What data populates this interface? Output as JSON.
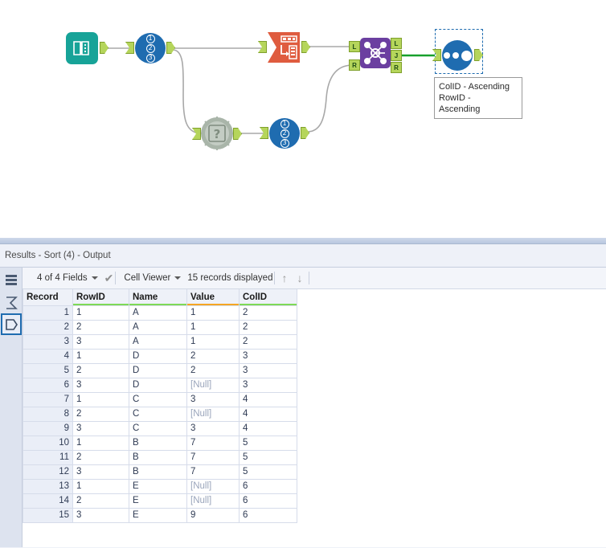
{
  "canvas": {
    "nodes": [
      {
        "id": "input-data",
        "name": "Input Data",
        "type": "input"
      },
      {
        "id": "record-id-1",
        "name": "Record ID",
        "type": "recordid",
        "digits": [
          "1",
          "2",
          "3"
        ]
      },
      {
        "id": "transpose",
        "name": "Transpose",
        "type": "transpose"
      },
      {
        "id": "unknown-tool",
        "name": "Unknown Tool",
        "type": "unknown",
        "glyph": "?"
      },
      {
        "id": "record-id-2",
        "name": "Record ID",
        "type": "recordid",
        "digits": [
          "1",
          "2",
          "3"
        ]
      },
      {
        "id": "join",
        "name": "Join",
        "type": "join",
        "ports": [
          "L",
          "J",
          "R"
        ]
      },
      {
        "id": "sort",
        "name": "Sort",
        "type": "sort",
        "selected": true
      }
    ],
    "annotation": {
      "lines": [
        "ColID - Ascending",
        "RowID -",
        "Ascending"
      ]
    },
    "colors": {
      "input_node": "#17a398",
      "recordid_node": "#1f6cb0",
      "transpose_node": "#df5c3f",
      "join_node": "#6b3fa0",
      "sort_node": "#1f6cb0",
      "unknown_node": "#9aa79a",
      "connector_plug": "#b5d55b",
      "wire": "#a8a8a8",
      "wire_active": "#17a02c",
      "selection": "#1f6cb0"
    }
  },
  "results": {
    "title": "Results - Sort (4) - Output",
    "toolbar": {
      "fields_label": "4 of 4 Fields",
      "check_icon": "✔",
      "viewer_label": "Cell Viewer",
      "records_label": "15 records displayed",
      "up_icon": "↑",
      "down_icon": "↓"
    },
    "rail": {
      "items": [
        {
          "name": "data-rows-icon",
          "selected": false
        },
        {
          "name": "sigma-icon",
          "selected": false
        },
        {
          "name": "tag-icon",
          "selected": true
        }
      ]
    },
    "grid": {
      "record_header": "Record",
      "columns": [
        {
          "label": "RowID",
          "type_color": "#7ed957"
        },
        {
          "label": "Name",
          "type_color": "#7ed957"
        },
        {
          "label": "Value",
          "type_color": "#f5a623"
        },
        {
          "label": "ColID",
          "type_color": "#7ed957"
        }
      ],
      "rows": [
        {
          "record": "1",
          "cells": [
            "1",
            "A",
            "1",
            "2"
          ]
        },
        {
          "record": "2",
          "cells": [
            "2",
            "A",
            "1",
            "2"
          ]
        },
        {
          "record": "3",
          "cells": [
            "3",
            "A",
            "1",
            "2"
          ]
        },
        {
          "record": "4",
          "cells": [
            "1",
            "D",
            "2",
            "3"
          ]
        },
        {
          "record": "5",
          "cells": [
            "2",
            "D",
            "2",
            "3"
          ]
        },
        {
          "record": "6",
          "cells": [
            "3",
            "D",
            "[Null]",
            "3"
          ]
        },
        {
          "record": "7",
          "cells": [
            "1",
            "C",
            "3",
            "4"
          ]
        },
        {
          "record": "8",
          "cells": [
            "2",
            "C",
            "[Null]",
            "4"
          ]
        },
        {
          "record": "9",
          "cells": [
            "3",
            "C",
            "3",
            "4"
          ]
        },
        {
          "record": "10",
          "cells": [
            "1",
            "B",
            "7",
            "5"
          ]
        },
        {
          "record": "11",
          "cells": [
            "2",
            "B",
            "7",
            "5"
          ]
        },
        {
          "record": "12",
          "cells": [
            "3",
            "B",
            "7",
            "5"
          ]
        },
        {
          "record": "13",
          "cells": [
            "1",
            "E",
            "[Null]",
            "6"
          ]
        },
        {
          "record": "14",
          "cells": [
            "2",
            "E",
            "[Null]",
            "6"
          ]
        },
        {
          "record": "15",
          "cells": [
            "3",
            "E",
            "9",
            "6"
          ]
        }
      ],
      "null_token": "[Null]"
    }
  }
}
